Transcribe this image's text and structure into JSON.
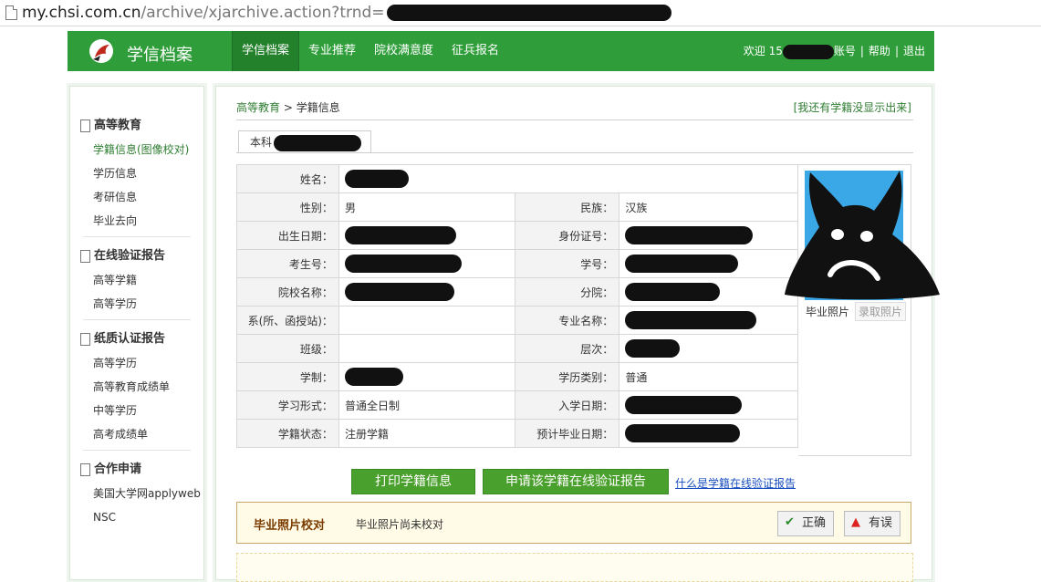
{
  "url": {
    "host": "my.chsi.com.cn",
    "path": "/archive/xjarchive.action?trnd="
  },
  "header": {
    "logo_text": "学信档案",
    "nav": [
      "学信档案",
      "专业推荐",
      "院校满意度",
      "征兵报名"
    ],
    "welcome_prefix": "欢迎 15",
    "account_suffix": "账号",
    "help": "帮助",
    "logout": "退出"
  },
  "sidebar": {
    "groups": [
      {
        "title": "高等教育",
        "items": [
          "学籍信息(图像校对)",
          "学历信息",
          "考研信息",
          "毕业去向"
        ]
      },
      {
        "title": "在线验证报告",
        "items": [
          "高等学籍",
          "高等学历"
        ]
      },
      {
        "title": "纸质认证报告",
        "items": [
          "高等学历",
          "高等教育成绩单",
          "中等学历",
          "高考成绩单"
        ]
      },
      {
        "title": "合作申请",
        "items": [
          "美国大学网applyweb",
          "NSC"
        ]
      }
    ]
  },
  "breadcrumb": {
    "root": "高等教育",
    "sep": " > ",
    "current": "学籍信息"
  },
  "missing_link": "[我还有学籍没显示出来]",
  "tab_label": "本科",
  "record": {
    "name_label": "姓名：",
    "gender_label": "性别：",
    "gender": "男",
    "ethnic_label": "民族：",
    "ethnic": "汉族",
    "birth_label": "出生日期：",
    "id_label": "身份证号：",
    "exam_no_label": "考生号：",
    "student_no_label": "学号：",
    "school_label": "院校名称：",
    "branch_label": "分院：",
    "dept_label": "系(所、函授站)：",
    "major_label": "专业名称：",
    "class_label": "班级：",
    "level_label": "层次：",
    "duration_label": "学制：",
    "category_label": "学历类别：",
    "category": "普通",
    "form_label": "学习形式：",
    "form": "普通全日制",
    "enroll_label": "入学日期：",
    "status_label": "学籍状态：",
    "status": "注册学籍",
    "grad_label": "预计毕业日期："
  },
  "photo": {
    "caption": "毕业照片",
    "button": "录取照片"
  },
  "buttons": {
    "print": "打印学籍信息",
    "apply": "申请该学籍在线验证报告",
    "help": "什么是学籍在线验证报告"
  },
  "verify": {
    "title": "毕业照片校对",
    "status": "毕业照片尚未校对",
    "correct": "正确",
    "wrong": "有误"
  },
  "colors": {
    "brand_green": "#2f9e3a",
    "status_red": "#e02020",
    "link_blue": "#1a4fbf"
  }
}
